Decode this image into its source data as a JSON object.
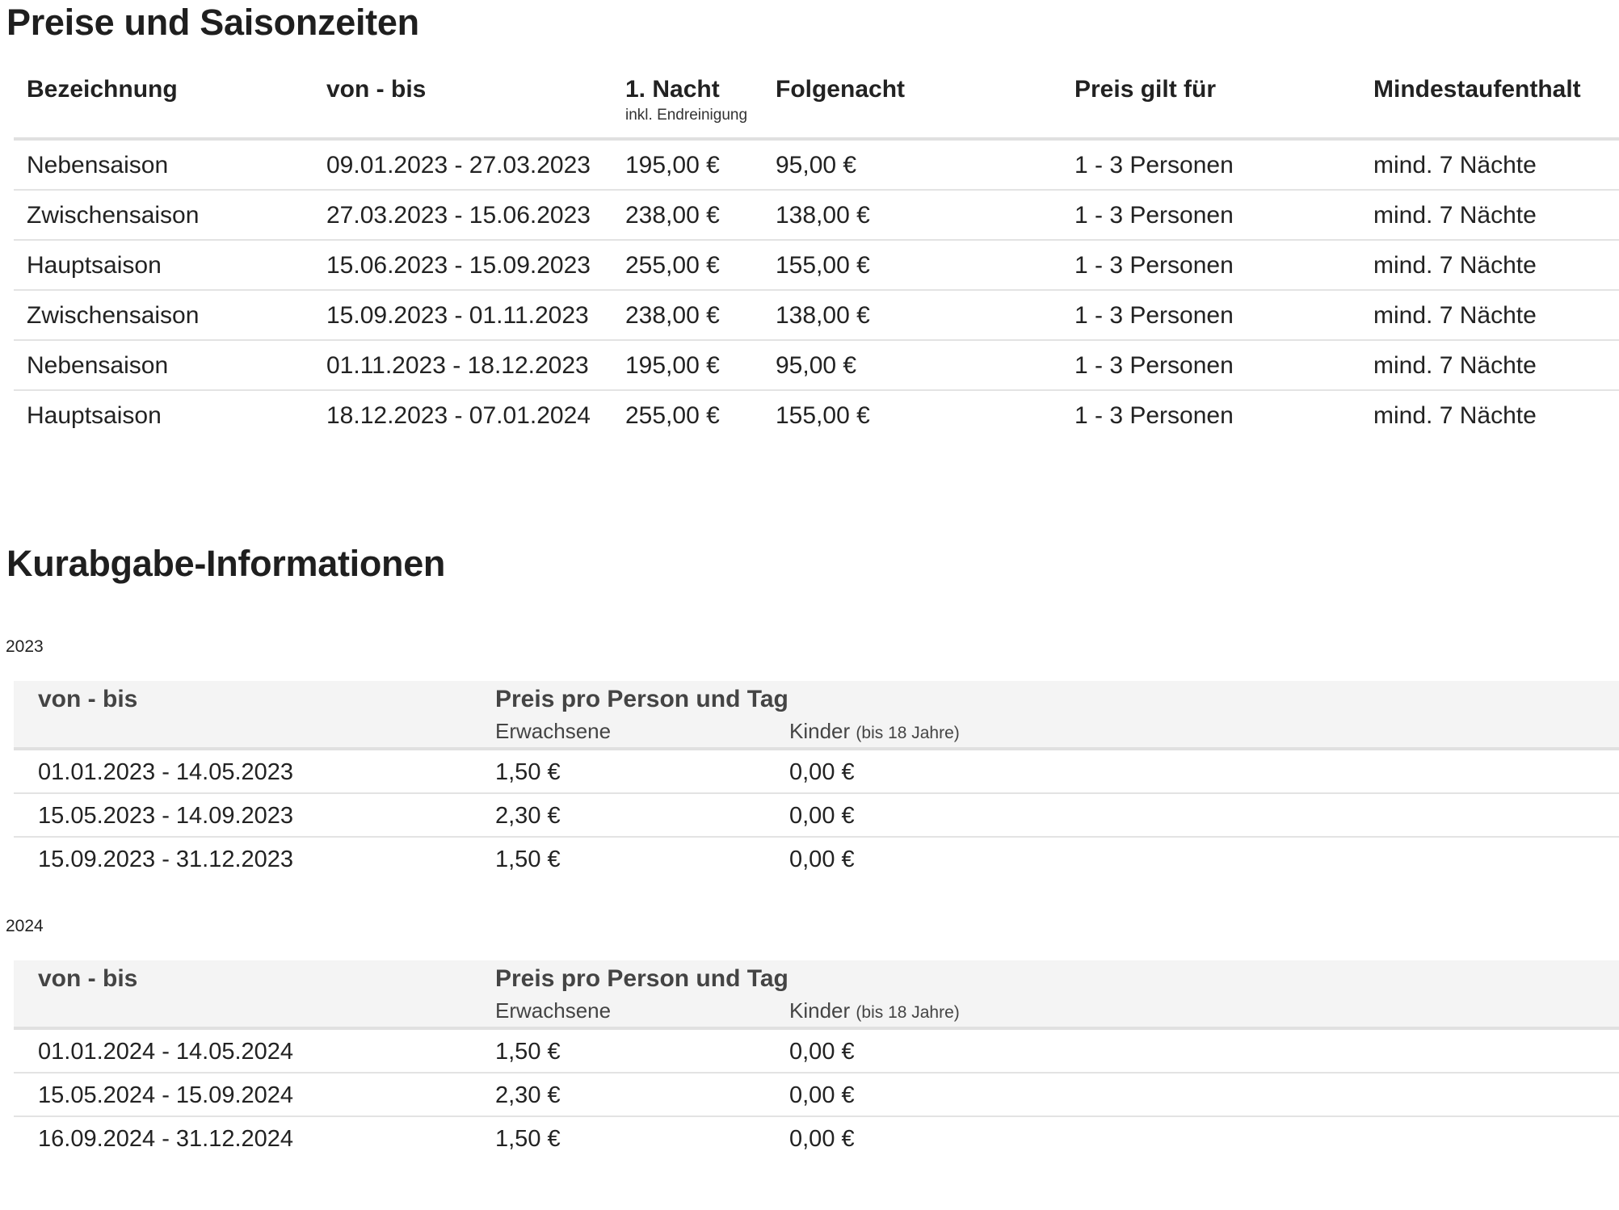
{
  "prices": {
    "title": "Preise und Saisonzeiten",
    "headers": {
      "name": "Bezeichnung",
      "period": "von - bis",
      "first_night": "1. Nacht",
      "first_night_note": "inkl. Endreinigung",
      "next_night": "Folgenacht",
      "valid_for": "Preis gilt für",
      "min_stay": "Mindestaufenthalt"
    },
    "rows": [
      {
        "name": "Nebensaison",
        "period": "09.01.2023 - 27.03.2023",
        "first_night": "195,00 €",
        "next_night": "95,00 €",
        "valid_for": "1 - 3 Personen",
        "min_stay": "mind. 7 Nächte"
      },
      {
        "name": "Zwischensaison",
        "period": "27.03.2023 - 15.06.2023",
        "first_night": "238,00 €",
        "next_night": "138,00 €",
        "valid_for": "1 - 3 Personen",
        "min_stay": "mind. 7 Nächte"
      },
      {
        "name": "Hauptsaison",
        "period": "15.06.2023 - 15.09.2023",
        "first_night": "255,00 €",
        "next_night": "155,00 €",
        "valid_for": "1 - 3 Personen",
        "min_stay": "mind. 7 Nächte"
      },
      {
        "name": "Zwischensaison",
        "period": "15.09.2023 - 01.11.2023",
        "first_night": "238,00 €",
        "next_night": "138,00 €",
        "valid_for": "1 - 3 Personen",
        "min_stay": "mind. 7 Nächte"
      },
      {
        "name": "Nebensaison",
        "period": "01.11.2023 - 18.12.2023",
        "first_night": "195,00 €",
        "next_night": "95,00 €",
        "valid_for": "1 - 3 Personen",
        "min_stay": "mind. 7 Nächte"
      },
      {
        "name": "Hauptsaison",
        "period": "18.12.2023 - 07.01.2024",
        "first_night": "255,00 €",
        "next_night": "155,00 €",
        "valid_for": "1 - 3 Personen",
        "min_stay": "mind. 7 Nächte"
      }
    ]
  },
  "kurabgabe": {
    "title": "Kurabgabe-Informationen",
    "headers": {
      "period": "von - bis",
      "price": "Preis pro Person und Tag",
      "adults": "Erwachsene",
      "children": "Kinder",
      "children_note": "(bis 18 Jahre)"
    },
    "years": [
      {
        "year": "2023",
        "rows": [
          {
            "period": "01.01.2023 - 14.05.2023",
            "adults": "1,50 €",
            "children": "0,00 €"
          },
          {
            "period": "15.05.2023 - 14.09.2023",
            "adults": "2,30 €",
            "children": "0,00 €"
          },
          {
            "period": "15.09.2023 - 31.12.2023",
            "adults": "1,50 €",
            "children": "0,00 €"
          }
        ]
      },
      {
        "year": "2024",
        "rows": [
          {
            "period": "01.01.2024 - 14.05.2024",
            "adults": "1,50 €",
            "children": "0,00 €"
          },
          {
            "period": "15.05.2024 - 15.09.2024",
            "adults": "2,30 €",
            "children": "0,00 €"
          },
          {
            "period": "16.09.2024 - 31.12.2024",
            "adults": "1,50 €",
            "children": "0,00 €"
          }
        ]
      }
    ]
  }
}
